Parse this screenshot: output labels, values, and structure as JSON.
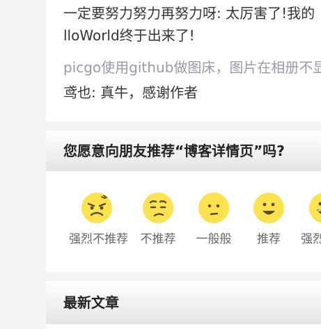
{
  "comments": {
    "lines": [
      "一定要努力努力再努力呀: 太厉害了!我的",
      "lloWorld终于出来了!",
      "picgo使用github做图床，图片在相册不显",
      "鸢也: 真牛，感谢作者"
    ]
  },
  "recommend": {
    "title": "您愿意向朋友推荐“博客详情页”吗?",
    "options": [
      {
        "label": "强烈不推荐",
        "icon": "angry-face-icon"
      },
      {
        "label": "不推荐",
        "icon": "sad-face-icon"
      },
      {
        "label": "一般般",
        "icon": "neutral-face-icon"
      },
      {
        "label": "推荐",
        "icon": "smile-face-icon"
      },
      {
        "label": "强烈推荐",
        "icon": "grin-face-icon"
      }
    ],
    "face_color": "#fde24f",
    "feature_color": "#5a4a1e"
  },
  "latest": {
    "title": "最新文章"
  }
}
